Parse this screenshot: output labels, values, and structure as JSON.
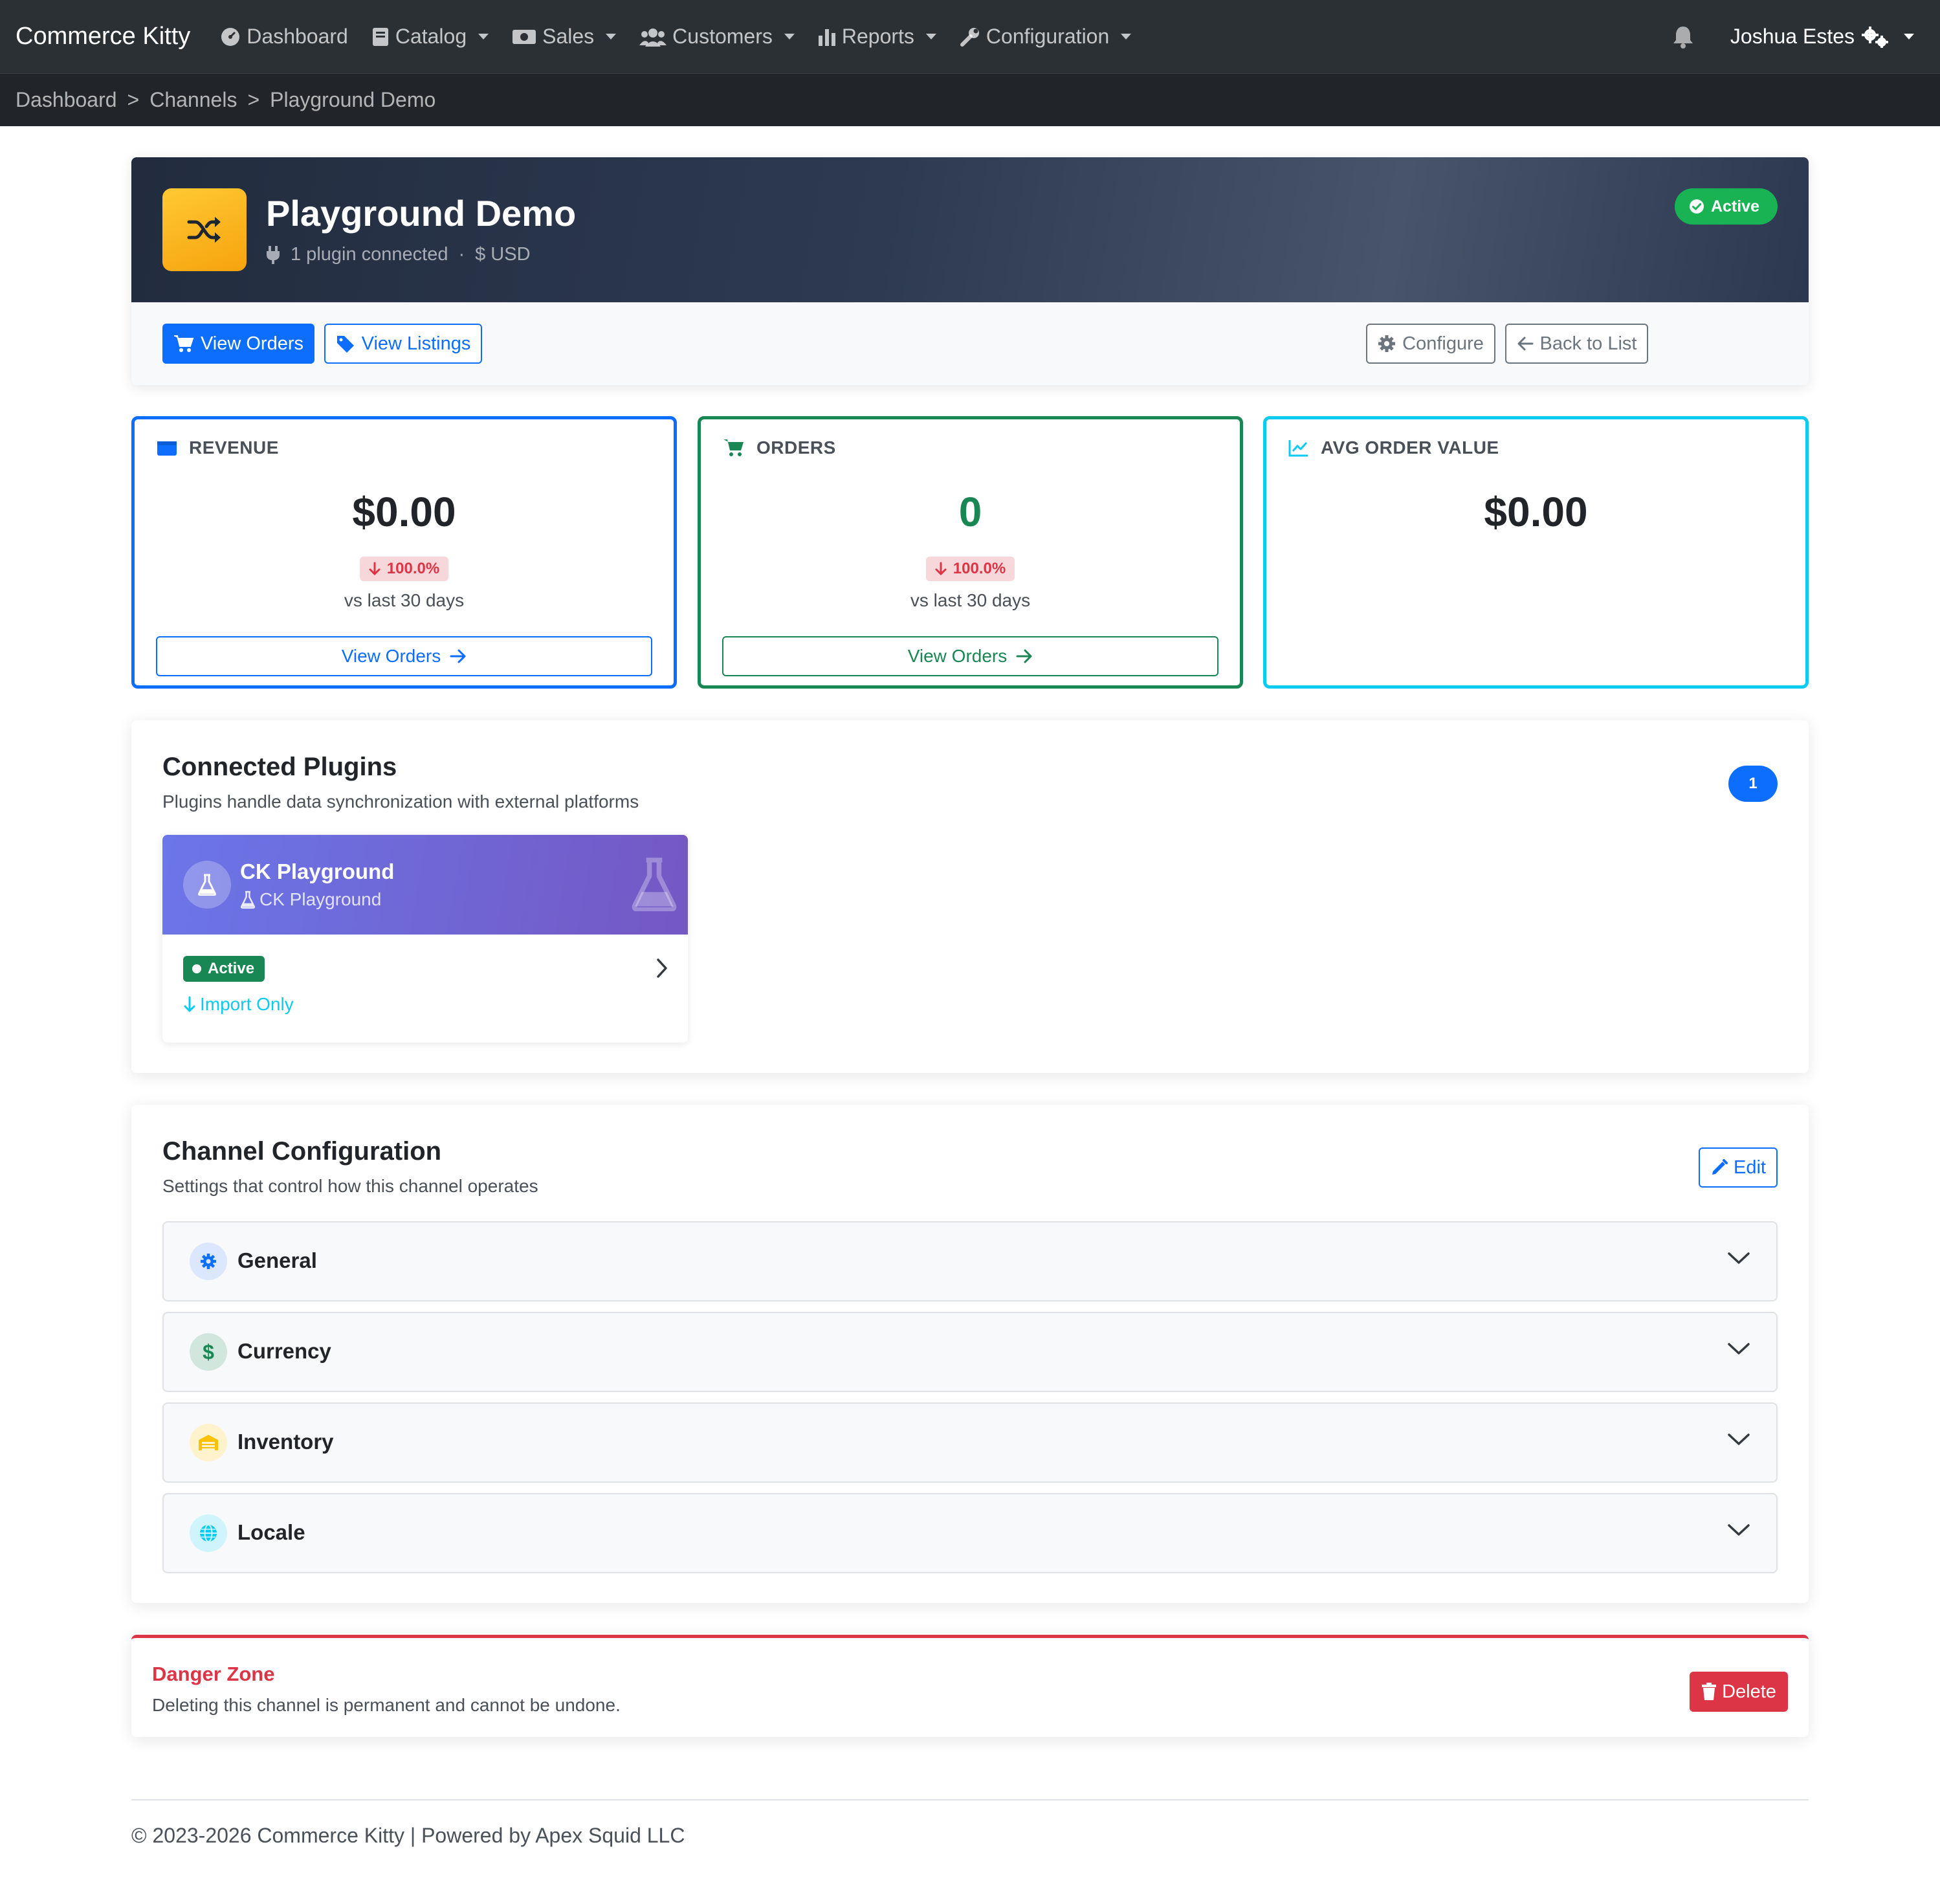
{
  "navbar": {
    "brand": "Commerce Kitty",
    "items": [
      {
        "label": "Dashboard",
        "icon": "dashboard-icon"
      },
      {
        "label": "Catalog",
        "icon": "book-icon"
      },
      {
        "label": "Sales",
        "icon": "money-icon"
      },
      {
        "label": "Customers",
        "icon": "users-icon"
      },
      {
        "label": "Reports",
        "icon": "bar-chart-icon"
      },
      {
        "label": "Configuration",
        "icon": "wrench-icon"
      }
    ],
    "user_name": "Joshua Estes"
  },
  "breadcrumb": [
    "Dashboard",
    "Channels",
    "Playground Demo"
  ],
  "channel": {
    "name": "Playground Demo",
    "plugins_connected": "1 plugin connected",
    "currency": "USD",
    "status": "Active",
    "actions": {
      "view_orders": "View Orders",
      "view_listings": "View Listings",
      "configure": "Configure",
      "back": "Back to List"
    }
  },
  "stats": {
    "revenue": {
      "label": "REVENUE",
      "value": "$0.00",
      "change": "100.0%",
      "note": "vs last 30 days",
      "link": "View Orders"
    },
    "orders": {
      "label": "ORDERS",
      "value": "0",
      "change": "100.0%",
      "note": "vs last 30 days",
      "link": "View Orders"
    },
    "aov": {
      "label": "AVG ORDER VALUE",
      "value": "$0.00"
    }
  },
  "plugins_panel": {
    "title": "Connected Plugins",
    "description": "Plugins handle data synchronization with external platforms",
    "count": "1",
    "plugin": {
      "name": "CK Playground",
      "type": "CK Playground",
      "status": "Active",
      "mode": "Import Only"
    }
  },
  "config_panel": {
    "title": "Channel Configuration",
    "description": "Settings that control how this channel operates",
    "edit": "Edit",
    "sections": [
      "General",
      "Currency",
      "Inventory",
      "Locale"
    ]
  },
  "danger": {
    "title": "Danger Zone",
    "description": "Deleting this channel is permanent and cannot be undone.",
    "delete": "Delete"
  },
  "footer": "© 2023-2026 Commerce Kitty | Powered by Apex Squid LLC",
  "colors": {
    "primary": "#0d6efd",
    "success": "#198754",
    "info": "#0dcaf0",
    "danger": "#dc3545",
    "warning": "#ffc107"
  }
}
